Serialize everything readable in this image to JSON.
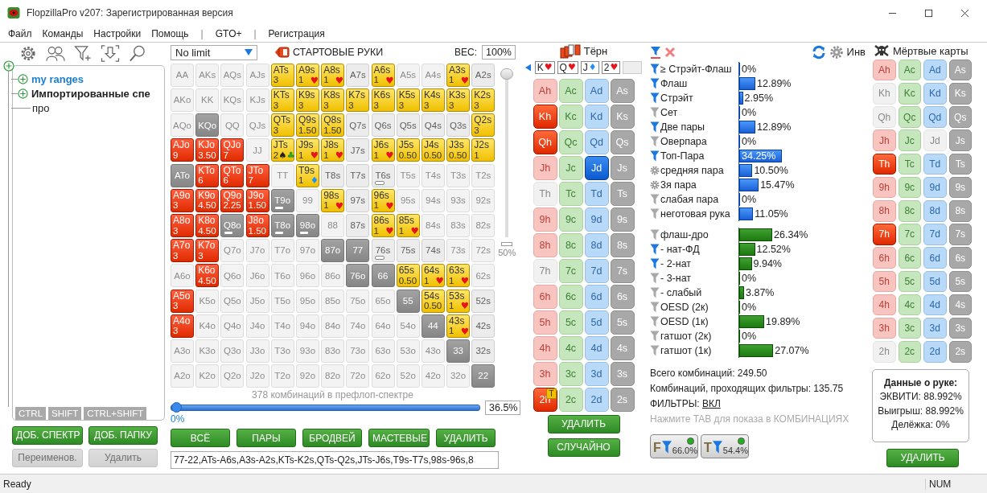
{
  "window": {
    "title": "FlopzillaPro v207: Зарегистрированная версия"
  },
  "menu": [
    {
      "label": "Файл",
      "kind": "item"
    },
    {
      "label": "Команды",
      "kind": "item"
    },
    {
      "label": "Настройки",
      "kind": "item"
    },
    {
      "label": "Помощь",
      "kind": "item"
    },
    {
      "label": "|",
      "kind": "separator"
    },
    {
      "label": "GTO+",
      "kind": "item"
    },
    {
      "label": "|",
      "kind": "separator"
    },
    {
      "label": "Регистрация",
      "kind": "item"
    }
  ],
  "tree": {
    "items": [
      {
        "label": "my ranges",
        "kind": "user_folder"
      },
      {
        "label": "Импортированные спе",
        "kind": "folder"
      },
      {
        "label": "про",
        "kind": "range"
      }
    ],
    "modifier_tabs": [
      "CTRL",
      "SHIFT",
      "CTRL+SHIFT"
    ],
    "buttons": [
      {
        "label": "ДОБ. СПЕКТР",
        "disabled": false
      },
      {
        "label": "ДОБ. ПАПКУ",
        "disabled": false
      },
      {
        "label": "Переименов.",
        "disabled": true
      },
      {
        "label": "Удалить",
        "disabled": true
      }
    ]
  },
  "range": {
    "game_select": "No limit",
    "title": "СТАРТОВЫЕ РУКИ",
    "weight_label": "ВЕС:",
    "weight_value": "100%",
    "vertical_slider": {
      "level": 1,
      "label": "50%"
    },
    "grid": [
      {
        "cells": [
          {
            "label": "AA",
            "kind": "empty",
            "partial": false
          },
          {
            "label": "AKs",
            "kind": "empty",
            "partial": false
          },
          {
            "label": "AQs",
            "kind": "empty",
            "partial": false
          },
          {
            "label": "AJs",
            "kind": "empty",
            "partial": false
          },
          {
            "label": "ATs",
            "kind": "suited",
            "weight": "3",
            "partial": false
          },
          {
            "label": "A9s",
            "kind": "suited",
            "weight": "1",
            "suits": [
              {
                "symbol": "♥",
                "kind": "heart"
              }
            ],
            "partial": false
          },
          {
            "label": "A8s",
            "kind": "suited",
            "weight": "1",
            "suits": [
              {
                "symbol": "♥",
                "kind": "heart"
              }
            ],
            "partial": false
          },
          {
            "label": "A7s",
            "kind": "plain",
            "partial": false
          },
          {
            "label": "A6s",
            "kind": "suited",
            "weight": "1",
            "suits": [
              {
                "symbol": "♥",
                "kind": "heart"
              }
            ],
            "partial": false
          },
          {
            "label": "A5s",
            "kind": "empty",
            "partial": false
          },
          {
            "label": "A4s",
            "kind": "empty",
            "partial": false
          },
          {
            "label": "A3s",
            "kind": "suited",
            "weight": "1",
            "suits": [
              {
                "symbol": "♥",
                "kind": "heart"
              }
            ],
            "partial": false
          },
          {
            "label": "A2s",
            "kind": "plain",
            "partial": false
          }
        ]
      },
      {
        "cells": [
          {
            "label": "AKo",
            "kind": "empty",
            "partial": false
          },
          {
            "label": "KK",
            "kind": "empty",
            "partial": false
          },
          {
            "label": "KQs",
            "kind": "empty",
            "partial": false
          },
          {
            "label": "KJs",
            "kind": "empty",
            "partial": false
          },
          {
            "label": "KTs",
            "kind": "suited",
            "weight": "3",
            "partial": false
          },
          {
            "label": "K9s",
            "kind": "suited",
            "weight": "3",
            "partial": false
          },
          {
            "label": "K8s",
            "kind": "suited",
            "weight": "3",
            "partial": false
          },
          {
            "label": "K7s",
            "kind": "suited",
            "weight": "3",
            "partial": false
          },
          {
            "label": "K6s",
            "kind": "suited",
            "weight": "3",
            "partial": false
          },
          {
            "label": "K5s",
            "kind": "suited",
            "weight": "3",
            "partial": false
          },
          {
            "label": "K4s",
            "kind": "suited",
            "weight": "3",
            "partial": false
          },
          {
            "label": "K3s",
            "kind": "suited",
            "weight": "3",
            "partial": false
          },
          {
            "label": "K2s",
            "kind": "suited",
            "weight": "3",
            "partial": false
          }
        ]
      },
      {
        "cells": [
          {
            "label": "AQo",
            "kind": "empty",
            "partial": false
          },
          {
            "label": "KQo",
            "kind": "dead",
            "partial": false
          },
          {
            "label": "QQ",
            "kind": "empty",
            "partial": false
          },
          {
            "label": "QJs",
            "kind": "empty",
            "partial": false
          },
          {
            "label": "QTs",
            "kind": "suited",
            "weight": "3",
            "partial": false
          },
          {
            "label": "Q9s",
            "kind": "suited",
            "weight": "1.50",
            "partial": false
          },
          {
            "label": "Q8s",
            "kind": "suited",
            "weight": "1.50",
            "partial": false
          },
          {
            "label": "Q7s",
            "kind": "plain",
            "partial": false
          },
          {
            "label": "Q6s",
            "kind": "plain",
            "partial": false
          },
          {
            "label": "Q5s",
            "kind": "plain",
            "partial": false
          },
          {
            "label": "Q4s",
            "kind": "plain",
            "partial": false
          },
          {
            "label": "Q3s",
            "kind": "plain",
            "partial": false
          },
          {
            "label": "Q2s",
            "kind": "suited",
            "weight": "3",
            "partial": false
          }
        ]
      },
      {
        "cells": [
          {
            "label": "AJo",
            "kind": "offsuit",
            "weight": "9",
            "partial": false
          },
          {
            "label": "KJo",
            "kind": "offsuit",
            "weight": "3.50",
            "partial": false
          },
          {
            "label": "QJo",
            "kind": "offsuit",
            "weight": "7",
            "partial": false
          },
          {
            "label": "JJ",
            "kind": "empty",
            "partial": false
          },
          {
            "label": "JTs",
            "kind": "suited",
            "weight": "2",
            "suits": [
              {
                "symbol": "♠",
                "kind": "spade"
              },
              {
                "symbol": "♣",
                "kind": "club"
              }
            ],
            "partial": false
          },
          {
            "label": "J9s",
            "kind": "suited",
            "weight": "1",
            "suits": [
              {
                "symbol": "♥",
                "kind": "heart"
              }
            ],
            "partial": false
          },
          {
            "label": "J8s",
            "kind": "suited",
            "weight": "1",
            "suits": [
              {
                "symbol": "♥",
                "kind": "heart"
              }
            ],
            "partial": false
          },
          {
            "label": "J7s",
            "kind": "plain",
            "partial": false
          },
          {
            "label": "J6s",
            "kind": "suited",
            "weight": "1",
            "suits": [
              {
                "symbol": "♥",
                "kind": "heart"
              }
            ],
            "partial": false
          },
          {
            "label": "J5s",
            "kind": "suited",
            "weight": "0.50",
            "partial": false
          },
          {
            "label": "J4s",
            "kind": "suited",
            "weight": "0.50",
            "partial": false
          },
          {
            "label": "J3s",
            "kind": "suited",
            "weight": "0.50",
            "partial": false
          },
          {
            "label": "J2s",
            "kind": "suited",
            "weight": "1",
            "partial": false
          }
        ]
      },
      {
        "cells": [
          {
            "label": "ATo",
            "kind": "dead",
            "partial": false
          },
          {
            "label": "KTo",
            "kind": "offsuit",
            "weight": "6",
            "partial": false
          },
          {
            "label": "QTo",
            "kind": "offsuit",
            "weight": "6",
            "partial": false
          },
          {
            "label": "JTo",
            "kind": "offsuit",
            "weight": "7",
            "partial": false
          },
          {
            "label": "TT",
            "kind": "empty",
            "partial": false
          },
          {
            "label": "T9s",
            "kind": "suited",
            "weight": "1",
            "suits": [
              {
                "symbol": "♦",
                "kind": "diamond"
              }
            ],
            "partial": false
          },
          {
            "label": "T8s",
            "kind": "plain",
            "partial": false
          },
          {
            "label": "T7s",
            "kind": "plain",
            "partial": false
          },
          {
            "label": "T6s",
            "kind": "plain",
            "partial": true
          },
          {
            "label": "T5s",
            "kind": "empty",
            "partial": false
          },
          {
            "label": "T4s",
            "kind": "empty",
            "partial": false
          },
          {
            "label": "T3s",
            "kind": "empty",
            "partial": false
          },
          {
            "label": "T2s",
            "kind": "empty",
            "partial": false
          }
        ]
      },
      {
        "cells": [
          {
            "label": "A9o",
            "kind": "offsuit",
            "weight": "3",
            "partial": false
          },
          {
            "label": "K9o",
            "kind": "offsuit",
            "weight": "4.50",
            "partial": false
          },
          {
            "label": "Q9o",
            "kind": "offsuit",
            "weight": "2.25",
            "partial": false
          },
          {
            "label": "J9o",
            "kind": "offsuit",
            "weight": "1.50",
            "partial": false
          },
          {
            "label": "T9o",
            "kind": "dead",
            "partial": true
          },
          {
            "label": "99",
            "kind": "empty",
            "partial": false
          },
          {
            "label": "98s",
            "kind": "suited",
            "weight": "1",
            "suits": [
              {
                "symbol": "♥",
                "kind": "heart"
              }
            ],
            "partial": false
          },
          {
            "label": "97s",
            "kind": "plain",
            "partial": false
          },
          {
            "label": "96s",
            "kind": "suited",
            "weight": "1",
            "suits": [
              {
                "symbol": "♥",
                "kind": "heart"
              }
            ],
            "partial": false
          },
          {
            "label": "95s",
            "kind": "empty",
            "partial": false
          },
          {
            "label": "94s",
            "kind": "empty",
            "partial": false
          },
          {
            "label": "93s",
            "kind": "empty",
            "partial": false
          },
          {
            "label": "92s",
            "kind": "empty",
            "partial": false
          }
        ]
      },
      {
        "cells": [
          {
            "label": "A8o",
            "kind": "offsuit",
            "weight": "3",
            "partial": false
          },
          {
            "label": "K8o",
            "kind": "offsuit",
            "weight": "4.50",
            "partial": false
          },
          {
            "label": "Q8o",
            "kind": "dead",
            "partial": true
          },
          {
            "label": "J8o",
            "kind": "offsuit",
            "weight": "1.50",
            "partial": false
          },
          {
            "label": "T8o",
            "kind": "dead",
            "partial": true
          },
          {
            "label": "98o",
            "kind": "dead",
            "partial": true
          },
          {
            "label": "88",
            "kind": "empty",
            "partial": false
          },
          {
            "label": "87s",
            "kind": "plain",
            "partial": false
          },
          {
            "label": "86s",
            "kind": "suited",
            "weight": "1",
            "suits": [
              {
                "symbol": "♥",
                "kind": "heart"
              }
            ],
            "partial": false
          },
          {
            "label": "85s",
            "kind": "suited",
            "weight": "1",
            "suits": [
              {
                "symbol": "♥",
                "kind": "heart"
              }
            ],
            "partial": false
          },
          {
            "label": "84s",
            "kind": "empty",
            "partial": false
          },
          {
            "label": "83s",
            "kind": "empty",
            "partial": false
          },
          {
            "label": "82s",
            "kind": "empty",
            "partial": false
          }
        ]
      },
      {
        "cells": [
          {
            "label": "A7o",
            "kind": "offsuit",
            "weight": "3",
            "partial": false
          },
          {
            "label": "K7o",
            "kind": "offsuit",
            "weight": "3",
            "partial": false
          },
          {
            "label": "Q7o",
            "kind": "empty",
            "partial": false
          },
          {
            "label": "J7o",
            "kind": "empty",
            "partial": false
          },
          {
            "label": "T7o",
            "kind": "empty",
            "partial": false
          },
          {
            "label": "97o",
            "kind": "empty",
            "partial": false
          },
          {
            "label": "87o",
            "kind": "dead",
            "partial": false
          },
          {
            "label": "77",
            "kind": "dead",
            "partial": false
          },
          {
            "label": "76s",
            "kind": "plain",
            "partial": true
          },
          {
            "label": "75s",
            "kind": "plain",
            "partial": false
          },
          {
            "label": "74s",
            "kind": "plain",
            "partial": false
          },
          {
            "label": "73s",
            "kind": "empty",
            "partial": false
          },
          {
            "label": "72s",
            "kind": "empty",
            "partial": false
          }
        ]
      },
      {
        "cells": [
          {
            "label": "A6o",
            "kind": "empty",
            "partial": false
          },
          {
            "label": "K6o",
            "kind": "offsuit",
            "weight": "4.50",
            "partial": false
          },
          {
            "label": "Q6o",
            "kind": "empty",
            "partial": false
          },
          {
            "label": "J6o",
            "kind": "empty",
            "partial": false
          },
          {
            "label": "T6o",
            "kind": "empty",
            "partial": false
          },
          {
            "label": "96o",
            "kind": "empty",
            "partial": false
          },
          {
            "label": "86o",
            "kind": "empty",
            "partial": false
          },
          {
            "label": "76o",
            "kind": "dead",
            "partial": false
          },
          {
            "label": "66",
            "kind": "dead",
            "partial": false
          },
          {
            "label": "65s",
            "kind": "suited",
            "weight": "0.50",
            "partial": false
          },
          {
            "label": "64s",
            "kind": "suited",
            "weight": "1",
            "suits": [
              {
                "symbol": "♥",
                "kind": "heart"
              }
            ],
            "partial": false
          },
          {
            "label": "63s",
            "kind": "suited",
            "weight": "1",
            "suits": [
              {
                "symbol": "♥",
                "kind": "heart"
              }
            ],
            "partial": false
          },
          {
            "label": "62s",
            "kind": "empty",
            "partial": false
          }
        ]
      },
      {
        "cells": [
          {
            "label": "A5o",
            "kind": "offsuit",
            "weight": "3",
            "partial": false
          },
          {
            "label": "K5o",
            "kind": "empty",
            "partial": false
          },
          {
            "label": "Q5o",
            "kind": "empty",
            "partial": false
          },
          {
            "label": "J5o",
            "kind": "empty",
            "partial": false
          },
          {
            "label": "T5o",
            "kind": "empty",
            "partial": false
          },
          {
            "label": "95o",
            "kind": "empty",
            "partial": false
          },
          {
            "label": "85o",
            "kind": "empty",
            "partial": false
          },
          {
            "label": "75o",
            "kind": "empty",
            "partial": false
          },
          {
            "label": "65o",
            "kind": "empty",
            "partial": false
          },
          {
            "label": "55",
            "kind": "dead",
            "partial": false
          },
          {
            "label": "54s",
            "kind": "suited",
            "weight": "0.50",
            "partial": false
          },
          {
            "label": "53s",
            "kind": "suited",
            "weight": "1",
            "suits": [
              {
                "symbol": "♥",
                "kind": "heart"
              }
            ],
            "partial": false
          },
          {
            "label": "52s",
            "kind": "plain",
            "partial": false
          }
        ]
      },
      {
        "cells": [
          {
            "label": "A4o",
            "kind": "offsuit",
            "weight": "3",
            "partial": false
          },
          {
            "label": "K4o",
            "kind": "empty",
            "partial": false
          },
          {
            "label": "Q4o",
            "kind": "empty",
            "partial": false
          },
          {
            "label": "J4o",
            "kind": "empty",
            "partial": false
          },
          {
            "label": "T4o",
            "kind": "empty",
            "partial": false
          },
          {
            "label": "94o",
            "kind": "empty",
            "partial": false
          },
          {
            "label": "84o",
            "kind": "empty",
            "partial": false
          },
          {
            "label": "74o",
            "kind": "empty",
            "partial": false
          },
          {
            "label": "64o",
            "kind": "empty",
            "partial": false
          },
          {
            "label": "54o",
            "kind": "empty",
            "partial": false
          },
          {
            "label": "44",
            "kind": "dead",
            "partial": false
          },
          {
            "label": "43s",
            "kind": "suited",
            "weight": "1",
            "suits": [
              {
                "symbol": "♥",
                "kind": "heart"
              }
            ],
            "partial": false
          },
          {
            "label": "42s",
            "kind": "plain",
            "partial": false
          }
        ]
      },
      {
        "cells": [
          {
            "label": "A3o",
            "kind": "empty",
            "partial": false
          },
          {
            "label": "K3o",
            "kind": "empty",
            "partial": false
          },
          {
            "label": "Q3o",
            "kind": "empty",
            "partial": false
          },
          {
            "label": "J3o",
            "kind": "empty",
            "partial": false
          },
          {
            "label": "T3o",
            "kind": "empty",
            "partial": false
          },
          {
            "label": "93o",
            "kind": "empty",
            "partial": false
          },
          {
            "label": "83o",
            "kind": "empty",
            "partial": false
          },
          {
            "label": "73o",
            "kind": "empty",
            "partial": false
          },
          {
            "label": "63o",
            "kind": "empty",
            "partial": false
          },
          {
            "label": "53o",
            "kind": "empty",
            "partial": false
          },
          {
            "label": "43o",
            "kind": "empty",
            "partial": false
          },
          {
            "label": "33",
            "kind": "dead",
            "partial": false
          },
          {
            "label": "32s",
            "kind": "plain",
            "partial": false
          }
        ]
      },
      {
        "cells": [
          {
            "label": "A2o",
            "kind": "empty",
            "partial": false
          },
          {
            "label": "K2o",
            "kind": "empty",
            "partial": false
          },
          {
            "label": "Q2o",
            "kind": "empty",
            "partial": false
          },
          {
            "label": "J2o",
            "kind": "empty",
            "partial": false
          },
          {
            "label": "T2o",
            "kind": "empty",
            "partial": false
          },
          {
            "label": "92o",
            "kind": "empty",
            "partial": false
          },
          {
            "label": "82o",
            "kind": "empty",
            "partial": false
          },
          {
            "label": "72o",
            "kind": "empty",
            "partial": false
          },
          {
            "label": "62o",
            "kind": "empty",
            "partial": false
          },
          {
            "label": "52o",
            "kind": "empty",
            "partial": false
          },
          {
            "label": "42o",
            "kind": "empty",
            "partial": false
          },
          {
            "label": "32o",
            "kind": "empty",
            "partial": false
          },
          {
            "label": "22",
            "kind": "dead",
            "partial": false
          }
        ]
      }
    ],
    "combos_label": "378 комбинаций в префлоп-спектре",
    "slider": {
      "level": 0,
      "min_label": "0%",
      "value": "36.5%"
    },
    "buttons": [
      "ВСЁ",
      "ПАРЫ",
      "БРОДВЕЙ",
      "МАСТЕВЫЕ",
      "УДАЛИТЬ"
    ],
    "range_text": "77-22,ATs-A6s,A3s-A2s,KTs-K2s,QTs-Q2s,JTs-J6s,T9s-T7s,98s-96s,8"
  },
  "turn": {
    "title": "Тёрн",
    "board": [
      {
        "rank": "K",
        "symbol": "♥",
        "kind": "heart"
      },
      {
        "rank": "Q",
        "symbol": "♥",
        "kind": "heart"
      },
      {
        "rank": "J",
        "symbol": "♦",
        "kind": "diamond"
      },
      {
        "rank": "2",
        "symbol": "♥",
        "kind": "heart"
      }
    ],
    "cards": [
      {
        "label": "Ah",
        "selected": false,
        "disabled": false
      },
      {
        "label": "Ac",
        "selected": false,
        "disabled": false
      },
      {
        "label": "Ad",
        "selected": false,
        "disabled": false
      },
      {
        "label": "As",
        "selected": false,
        "disabled": false
      },
      {
        "label": "Kh",
        "selected": true,
        "disabled": false
      },
      {
        "label": "Kc",
        "selected": false,
        "disabled": false
      },
      {
        "label": "Kd",
        "selected": false,
        "disabled": false
      },
      {
        "label": "Ks",
        "selected": false,
        "disabled": false
      },
      {
        "label": "Qh",
        "selected": true,
        "disabled": false
      },
      {
        "label": "Qc",
        "selected": false,
        "disabled": false
      },
      {
        "label": "Qd",
        "selected": false,
        "disabled": false
      },
      {
        "label": "Qs",
        "selected": false,
        "disabled": false
      },
      {
        "label": "Jh",
        "selected": false,
        "disabled": false
      },
      {
        "label": "Jc",
        "selected": false,
        "disabled": false
      },
      {
        "label": "Jd",
        "selected": true,
        "disabled": false
      },
      {
        "label": "Js",
        "selected": false,
        "disabled": false
      },
      {
        "label": "Th",
        "selected": false,
        "disabled": true
      },
      {
        "label": "Tc",
        "selected": false,
        "disabled": false
      },
      {
        "label": "Td",
        "selected": false,
        "disabled": false
      },
      {
        "label": "Ts",
        "selected": false,
        "disabled": false
      },
      {
        "label": "9h",
        "selected": false,
        "disabled": false
      },
      {
        "label": "9c",
        "selected": false,
        "disabled": false
      },
      {
        "label": "9d",
        "selected": false,
        "disabled": false
      },
      {
        "label": "9s",
        "selected": false,
        "disabled": false
      },
      {
        "label": "8h",
        "selected": false,
        "disabled": false
      },
      {
        "label": "8c",
        "selected": false,
        "disabled": false
      },
      {
        "label": "8d",
        "selected": false,
        "disabled": false
      },
      {
        "label": "8s",
        "selected": false,
        "disabled": false
      },
      {
        "label": "7h",
        "selected": false,
        "disabled": true
      },
      {
        "label": "7c",
        "selected": false,
        "disabled": false
      },
      {
        "label": "7d",
        "selected": false,
        "disabled": false
      },
      {
        "label": "7s",
        "selected": false,
        "disabled": false
      },
      {
        "label": "6h",
        "selected": false,
        "disabled": false
      },
      {
        "label": "6c",
        "selected": false,
        "disabled": false
      },
      {
        "label": "6d",
        "selected": false,
        "disabled": false
      },
      {
        "label": "6s",
        "selected": false,
        "disabled": false
      },
      {
        "label": "5h",
        "selected": false,
        "disabled": false
      },
      {
        "label": "5c",
        "selected": false,
        "disabled": false
      },
      {
        "label": "5d",
        "selected": false,
        "disabled": false
      },
      {
        "label": "5s",
        "selected": false,
        "disabled": false
      },
      {
        "label": "4h",
        "selected": false,
        "disabled": false
      },
      {
        "label": "4c",
        "selected": false,
        "disabled": false
      },
      {
        "label": "4d",
        "selected": false,
        "disabled": false
      },
      {
        "label": "4s",
        "selected": false,
        "disabled": false
      },
      {
        "label": "3h",
        "selected": false,
        "disabled": false
      },
      {
        "label": "3c",
        "selected": false,
        "disabled": false
      },
      {
        "label": "3d",
        "selected": false,
        "disabled": false
      },
      {
        "label": "3s",
        "selected": false,
        "disabled": false
      },
      {
        "label": "2h",
        "selected": true,
        "disabled": false,
        "badge": "T"
      },
      {
        "label": "2c",
        "selected": false,
        "disabled": false
      },
      {
        "label": "2d",
        "selected": false,
        "disabled": false
      },
      {
        "label": "2s",
        "selected": false,
        "disabled": false
      }
    ],
    "buttons": [
      "УДАЛИТЬ",
      "СЛУЧАЙНО"
    ]
  },
  "stats": {
    "invert_label": "Инв",
    "made_hands": [
      {
        "label": "≥ Стрэйт-Флаш",
        "kind": "filter",
        "active": true,
        "level": 0,
        "value": "0%",
        "selected": false
      },
      {
        "label": "Флаш",
        "kind": "filter",
        "active": true,
        "level": 0.1289,
        "value": "12.89%",
        "selected": false
      },
      {
        "label": "Стрэйт",
        "kind": "filter",
        "active": true,
        "level": 0.0295,
        "value": "2.95%",
        "selected": false
      },
      {
        "label": "Сет",
        "kind": "filter",
        "active": false,
        "level": 0,
        "value": "0%",
        "selected": false
      },
      {
        "label": "Две пары",
        "kind": "filter",
        "active": true,
        "level": 0.1289,
        "value": "12.89%",
        "selected": false
      },
      {
        "label": "Оверпара",
        "kind": "filter",
        "active": false,
        "level": 0,
        "value": "0%",
        "selected": false
      },
      {
        "label": "Топ-Пара",
        "kind": "filter",
        "active": true,
        "level": 0.3425,
        "value": "34.25%",
        "selected": true
      },
      {
        "label": "средняя пара",
        "kind": "gear",
        "active": false,
        "level": 0.105,
        "value": "10.50%",
        "selected": false
      },
      {
        "label": "3я пара",
        "kind": "gear",
        "active": false,
        "level": 0.1547,
        "value": "15.47%",
        "selected": false
      },
      {
        "label": "слабая пара",
        "kind": "filter",
        "active": false,
        "level": 0,
        "value": "0%",
        "selected": false
      },
      {
        "label": "неготовая рука",
        "kind": "filter",
        "active": false,
        "level": 0.1105,
        "value": "11.05%",
        "selected": false
      }
    ],
    "draws": [
      {
        "label": "флаш-дро",
        "kind": "filter",
        "active": false,
        "level": 0.2634,
        "value": "26.34%",
        "selected": false
      },
      {
        "label": "- нат-ФД",
        "kind": "filter",
        "active": true,
        "level": 0.1252,
        "value": "12.52%",
        "selected": false
      },
      {
        "label": "- 2-нат",
        "kind": "filter",
        "active": true,
        "level": 0.0994,
        "value": "9.94%",
        "selected": false
      },
      {
        "label": "- 3-нат",
        "kind": "filter",
        "active": false,
        "level": 0,
        "value": "0%",
        "selected": false
      },
      {
        "label": "- слабый",
        "kind": "filter",
        "active": false,
        "level": 0.0387,
        "value": "3.87%",
        "selected": false
      },
      {
        "label": "OESD (2к)",
        "kind": "filter",
        "active": false,
        "level": 0,
        "value": "0%",
        "selected": false
      },
      {
        "label": "OESD (1к)",
        "kind": "filter",
        "active": false,
        "level": 0.1989,
        "value": "19.89%",
        "selected": false
      },
      {
        "label": "гатшот (2к)",
        "kind": "filter",
        "active": false,
        "level": 0,
        "value": "0%",
        "selected": false
      },
      {
        "label": "гатшот (1к)",
        "kind": "filter",
        "active": false,
        "level": 0.2707,
        "value": "27.07%",
        "selected": false
      }
    ],
    "total": "Всего комбинаций: 249.50",
    "passing": "Комбинаций, проходящих фильтры: 135.75",
    "filters_label": "ФИЛЬТРЫ:",
    "filters_link": "ВКЛ",
    "hint": "Нажмите TAB для показа в КОМБИНАЦИЯХ",
    "filter_buttons": [
      {
        "letter": "F",
        "value": "66.0%",
        "on": true
      },
      {
        "letter": "T",
        "value": "54.4%",
        "on": true
      }
    ]
  },
  "dead_cards": {
    "title": "Мёртвые карты",
    "cards": [
      {
        "label": "Ah",
        "selected": false,
        "disabled": false
      },
      {
        "label": "Ac",
        "selected": false,
        "disabled": false
      },
      {
        "label": "Ad",
        "selected": false,
        "disabled": false
      },
      {
        "label": "As",
        "selected": false,
        "disabled": false
      },
      {
        "label": "Kh",
        "selected": false,
        "disabled": true
      },
      {
        "label": "Kc",
        "selected": false,
        "disabled": false
      },
      {
        "label": "Kd",
        "selected": false,
        "disabled": false
      },
      {
        "label": "Ks",
        "selected": false,
        "disabled": false
      },
      {
        "label": "Qh",
        "selected": false,
        "disabled": true
      },
      {
        "label": "Qc",
        "selected": false,
        "disabled": false
      },
      {
        "label": "Qd",
        "selected": false,
        "disabled": false
      },
      {
        "label": "Qs",
        "selected": false,
        "disabled": false
      },
      {
        "label": "Jh",
        "selected": false,
        "disabled": false
      },
      {
        "label": "Jc",
        "selected": false,
        "disabled": false
      },
      {
        "label": "Jd",
        "selected": false,
        "disabled": true
      },
      {
        "label": "Js",
        "selected": false,
        "disabled": false
      },
      {
        "label": "Th",
        "selected": true,
        "disabled": false
      },
      {
        "label": "Tc",
        "selected": false,
        "disabled": false
      },
      {
        "label": "Td",
        "selected": false,
        "disabled": false
      },
      {
        "label": "Ts",
        "selected": false,
        "disabled": false
      },
      {
        "label": "9h",
        "selected": false,
        "disabled": false
      },
      {
        "label": "9c",
        "selected": false,
        "disabled": false
      },
      {
        "label": "9d",
        "selected": false,
        "disabled": false
      },
      {
        "label": "9s",
        "selected": false,
        "disabled": false
      },
      {
        "label": "8h",
        "selected": false,
        "disabled": false
      },
      {
        "label": "8c",
        "selected": false,
        "disabled": false
      },
      {
        "label": "8d",
        "selected": false,
        "disabled": false
      },
      {
        "label": "8s",
        "selected": false,
        "disabled": false
      },
      {
        "label": "7h",
        "selected": true,
        "disabled": false
      },
      {
        "label": "7c",
        "selected": false,
        "disabled": false
      },
      {
        "label": "7d",
        "selected": false,
        "disabled": false
      },
      {
        "label": "7s",
        "selected": false,
        "disabled": false
      },
      {
        "label": "6h",
        "selected": false,
        "disabled": false
      },
      {
        "label": "6c",
        "selected": false,
        "disabled": false
      },
      {
        "label": "6d",
        "selected": false,
        "disabled": false
      },
      {
        "label": "6s",
        "selected": false,
        "disabled": false
      },
      {
        "label": "5h",
        "selected": false,
        "disabled": false
      },
      {
        "label": "5c",
        "selected": false,
        "disabled": false
      },
      {
        "label": "5d",
        "selected": false,
        "disabled": false
      },
      {
        "label": "5s",
        "selected": false,
        "disabled": false
      },
      {
        "label": "4h",
        "selected": false,
        "disabled": false
      },
      {
        "label": "4c",
        "selected": false,
        "disabled": false
      },
      {
        "label": "4d",
        "selected": false,
        "disabled": false
      },
      {
        "label": "4s",
        "selected": false,
        "disabled": false
      },
      {
        "label": "3h",
        "selected": false,
        "disabled": false
      },
      {
        "label": "3c",
        "selected": false,
        "disabled": false
      },
      {
        "label": "3d",
        "selected": false,
        "disabled": false
      },
      {
        "label": "3s",
        "selected": false,
        "disabled": false
      },
      {
        "label": "2h",
        "selected": false,
        "disabled": true
      },
      {
        "label": "2c",
        "selected": false,
        "disabled": false
      },
      {
        "label": "2d",
        "selected": false,
        "disabled": false
      },
      {
        "label": "2s",
        "selected": false,
        "disabled": false
      }
    ],
    "hand_data": {
      "title": "Данные о руке:",
      "lines": [
        "ЭКВИТИ: 88.992%",
        "Выигрыш: 88.992%",
        "Делёжка: 0%"
      ]
    },
    "button": "УДАЛИТЬ"
  },
  "status_bar": {
    "text": "Ready",
    "num": "NUM"
  }
}
